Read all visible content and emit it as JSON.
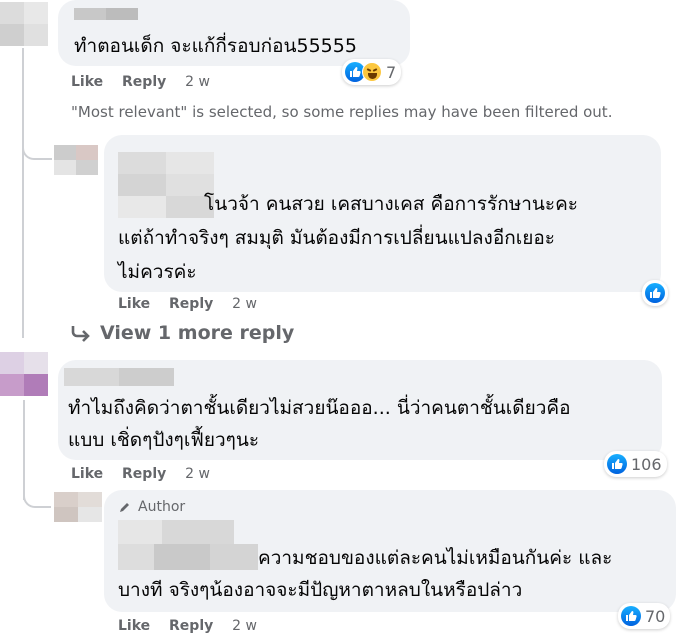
{
  "comments": [
    {
      "text_lines": [
        "ทำตอนเด็ก จะแก้กี่รอบก่อน55555"
      ],
      "actions": {
        "like": "Like",
        "reply": "Reply",
        "time": "2 w"
      },
      "reactions": {
        "icons": [
          "like-icon",
          "haha-icon"
        ],
        "count": "7"
      }
    },
    {
      "text_lines": [
        "โนวจ้า คนสวย เคสบางเคส คือการรักษานะคะ",
        "แต่ถ้าทำจริงๆ สมมุติ มันต้องมีการเปลี่ยนแปลงอีกเยอะ",
        "ไม่ควรค่ะ"
      ],
      "actions": {
        "like": "Like",
        "reply": "Reply",
        "time": "2 w"
      },
      "reactions": {
        "icons": [
          "like-icon"
        ],
        "count": ""
      }
    },
    {
      "text_lines": [
        "ทำไมถึงคิดว่าตาชั้นเดียวไม่สวยน๊อออ... นี่ว่าคนตาชั้นเดียวคือ",
        "แบบ เชิ่ดๆปังๆเฟี้ยวๆนะ"
      ],
      "actions": {
        "like": "Like",
        "reply": "Reply",
        "time": "2 w"
      },
      "reactions": {
        "icons": [
          "like-icon"
        ],
        "count": "106"
      }
    },
    {
      "badge": "Author",
      "text_lines": [
        "ความชอบของแต่ละคนไม่เหมือนกันค่ะ และ",
        "บางที จริงๆน้องอาจจะมีปัญหาตาหลบในหรือปล่าว"
      ],
      "actions": {
        "like": "Like",
        "reply": "Reply",
        "time": "2 w"
      },
      "reactions": {
        "icons": [
          "like-icon"
        ],
        "count": "70"
      }
    }
  ],
  "filter_note": "\"Most relevant\" is selected, so some replies may have been filtered out.",
  "more_replies": "View 1 more reply",
  "colors": {
    "bubble": "#f0f2f5",
    "meta": "#65676b",
    "like_blue": "#0866ff",
    "haha_yellow": "#fcc73f"
  }
}
